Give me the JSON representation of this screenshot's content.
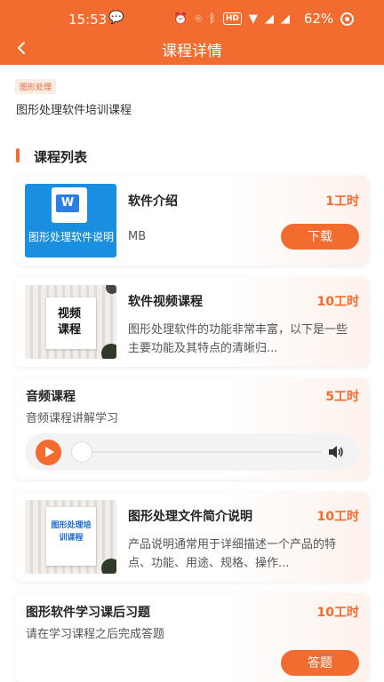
{
  "status_bar": {
    "time": "15:53",
    "chat_glyph": "💬",
    "icons": [
      "alarm-icon",
      "location-icon",
      "bluetooth-icon",
      "hd-icon",
      "wifi-icon",
      "signal-5g-icon",
      "signal-4g-icon"
    ],
    "hd": "HD",
    "battery": "62%"
  },
  "header": {
    "back_glyph": "<",
    "title": "课程详情"
  },
  "course": {
    "tag": "图形处理",
    "description": "图形处理软件培训课程"
  },
  "section": {
    "title": "课程列表"
  },
  "items": [
    {
      "type": "document",
      "title": "软件介绍",
      "hours": "1工时",
      "size": "MB",
      "button": "下载",
      "thumb_icon": "W",
      "thumb_text": "图形处理软件说明文档.do..."
    },
    {
      "type": "video",
      "title": "软件视频课程",
      "hours": "10工时",
      "description": "图形处理软件的功能非常丰富，以下是一些主要功能及其特点的清晰归...",
      "thumb_text": "视频课程"
    },
    {
      "type": "audio",
      "title": "音频课程",
      "hours": "5工时",
      "description": "音频课程讲解学习"
    },
    {
      "type": "image",
      "title": "图形处理文件简介说明",
      "hours": "10工时",
      "description": "产品说明通常用于详细描述一个产品的特点、功能、用途、规格、操作...",
      "thumb_text": "图形处理培训课程"
    },
    {
      "type": "exercise",
      "title": "图形软件学习课后习题",
      "hours": "10工时",
      "description": "请在学习课程之后完成答题",
      "button": "答题"
    }
  ],
  "colors": {
    "accent": "#f26b2f",
    "tag_bg": "#fbece5"
  }
}
